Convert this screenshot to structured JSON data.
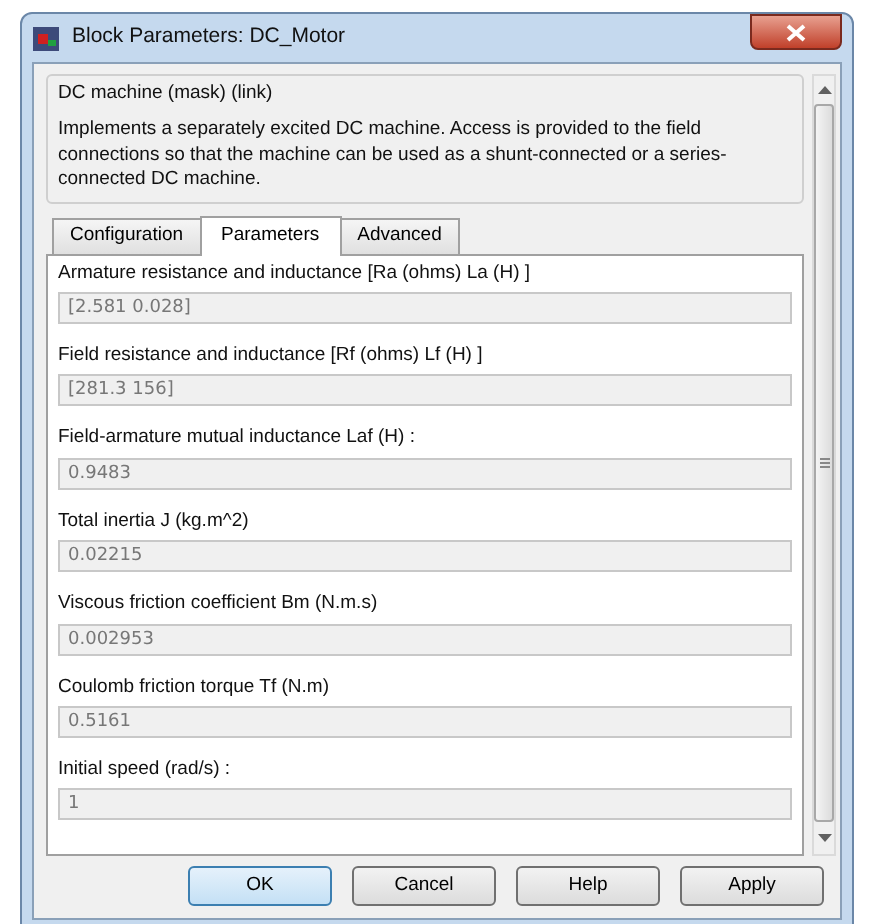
{
  "window": {
    "title": "Block Parameters: DC_Motor"
  },
  "group": {
    "title": "DC machine (mask) (link)",
    "description": "Implements a separately excited DC machine. Access is provided  to the field connections so that the machine can be used as a shunt-connected or a series-connected  DC machine."
  },
  "tabs": [
    {
      "label": "Configuration",
      "selected": false
    },
    {
      "label": "Parameters",
      "selected": true
    },
    {
      "label": "Advanced",
      "selected": false
    }
  ],
  "parameters": [
    {
      "label": "Armature resistance and inductance [Ra (ohms) La (H) ]",
      "value": "[2.581 0.028]",
      "disabled": true
    },
    {
      "label": "Field resistance and inductance [Rf (ohms) Lf (H) ]",
      "value": "[281.3 156]",
      "disabled": true
    },
    {
      "label": "Field-armature mutual inductance Laf (H) :",
      "value": "0.9483",
      "disabled": true
    },
    {
      "label": "Total inertia J (kg.m^2)",
      "value": "0.02215",
      "disabled": true
    },
    {
      "label": "Viscous friction coefficient Bm (N.m.s)",
      "value": "0.002953",
      "disabled": true
    },
    {
      "label": "Coulomb friction torque Tf (N.m)",
      "value": "0.5161",
      "disabled": true
    },
    {
      "label": "Initial speed (rad/s) :",
      "value": "1",
      "disabled": true
    }
  ],
  "buttons": [
    {
      "label": "OK",
      "default": true
    },
    {
      "label": "Cancel",
      "default": false
    },
    {
      "label": "Help",
      "default": false
    },
    {
      "label": "Apply",
      "default": false
    }
  ]
}
